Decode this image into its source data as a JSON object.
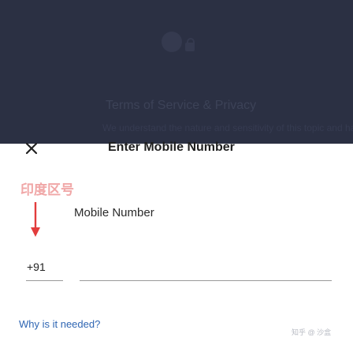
{
  "background": {
    "title": "Terms of Service & Privacy",
    "subtitle": "We understand the nature and sensitivity of this topic and have e"
  },
  "header": {
    "title": "Enter Mobile Number"
  },
  "annotation": {
    "watermark_text": "印度区号"
  },
  "form": {
    "label": "Mobile Number",
    "country_code": "+91",
    "phone_value": "",
    "phone_placeholder": ""
  },
  "help": {
    "link_text": "Why is it needed?"
  },
  "corner_watermark": "知乎 @ 沙盒",
  "colors": {
    "backdrop": "#2b3043",
    "link": "#2f66b3",
    "annotation_red": "#e23c3c",
    "watermark": "#f0a7a7"
  }
}
